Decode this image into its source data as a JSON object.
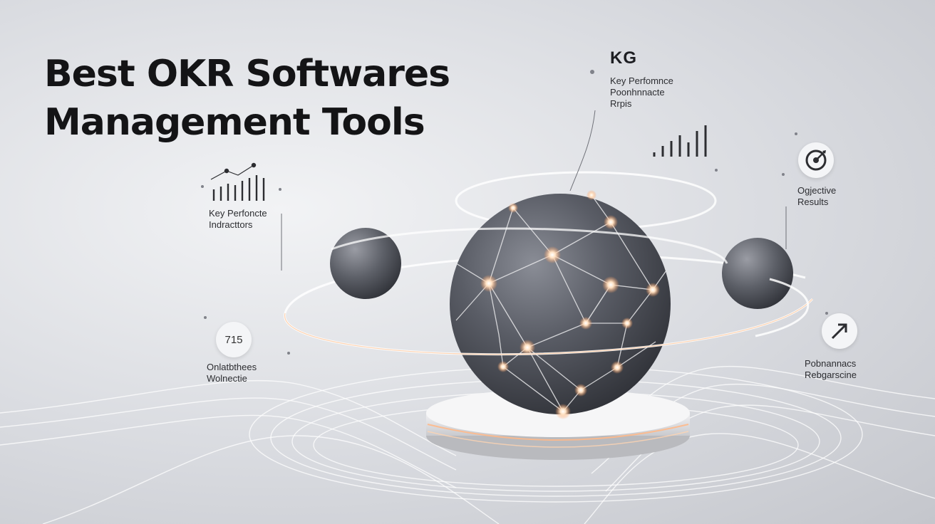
{
  "headline": {
    "line1": "Best OKR Softwares",
    "line2": "Management Tools"
  },
  "callouts": {
    "kg": {
      "code": "KG",
      "line1": "Key Perfomnce",
      "line2": "Poonhnnacte",
      "line3": "Rrpis"
    },
    "kpi": {
      "line1": "Key Perfoncte",
      "line2": "Indracttors"
    },
    "objective": {
      "line1": "Ogjective",
      "line2": "Results"
    },
    "value": {
      "number": "715",
      "line1": "Onlatbthees",
      "line2": "Wolnectie"
    },
    "performance": {
      "line1": "Pobnannacs",
      "line2": "Rebgarscine"
    }
  },
  "icons": {
    "bar_chart": "bar-chart-icon",
    "target": "target-icon",
    "arrow": "arrow-up-right-icon",
    "line_chart": "line-chart-icon"
  },
  "colors": {
    "background": "#dcdee2",
    "sphere": "#4f525a",
    "glow": "#ffd9b8",
    "text": "#141416"
  }
}
